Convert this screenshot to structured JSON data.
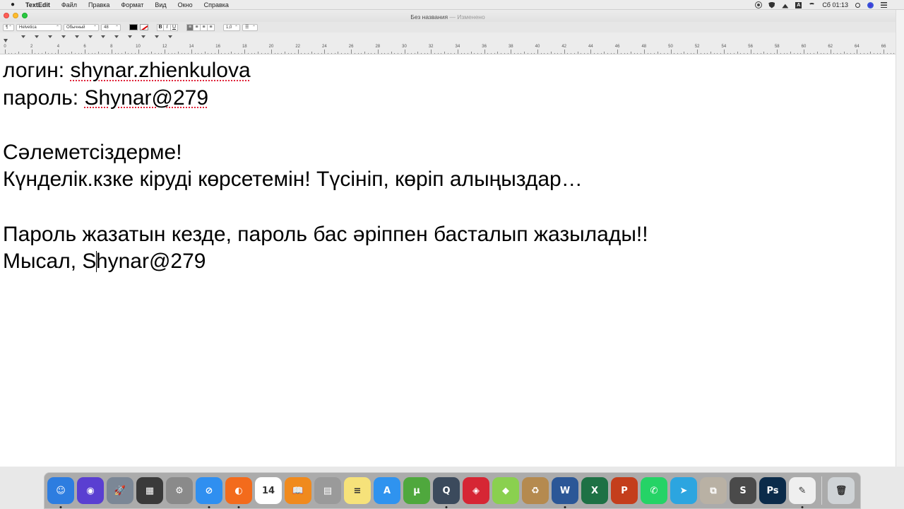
{
  "menubar": {
    "app_name": "TextEdit",
    "items": [
      "Файл",
      "Правка",
      "Формат",
      "Вид",
      "Окно",
      "Справка"
    ],
    "clock": "Сб 01:13"
  },
  "window": {
    "title": "Без названия",
    "title_sep": " — ",
    "edited": "Изменено"
  },
  "toolbar": {
    "paragraph_style": "¶",
    "font_family": "Helvetica",
    "font_style": "Обычный",
    "font_size": "48",
    "bold": "B",
    "italic": "I",
    "underline": "U",
    "line_spacing": "1,0",
    "list": "☰",
    "text_color": "#000000",
    "alignment_active": "left"
  },
  "ruler": {
    "labels": [
      "0",
      "2",
      "4",
      "6",
      "8",
      "10",
      "12",
      "14",
      "16",
      "18",
      "20",
      "22",
      "24",
      "26",
      "28",
      "30",
      "32",
      "34",
      "36",
      "38",
      "40",
      "42",
      "44",
      "46",
      "48",
      "50",
      "52",
      "54",
      "56",
      "58",
      "60",
      "62",
      "64",
      "66"
    ]
  },
  "document": {
    "lines": [
      {
        "prefix": "логин: ",
        "spell": "shynar.zhienkulova",
        "suffix": ""
      },
      {
        "prefix": "пароль: ",
        "spell": "Shynar@279",
        "suffix": ""
      },
      {
        "prefix": "",
        "spell": "",
        "suffix": ""
      },
      {
        "prefix": "Сәлеметсіздерме!",
        "spell": "",
        "suffix": ""
      },
      {
        "prefix": "Күнделік.кзке кіруді көрсетемін! Түсініп, көріп алыңыздар…",
        "spell": "",
        "suffix": ""
      },
      {
        "prefix": "",
        "spell": "",
        "suffix": ""
      },
      {
        "prefix": "Пароль жазатын кезде, пароль бас әріппен басталып жазылады!!",
        "spell": "",
        "suffix": ""
      }
    ],
    "last_line_before_caret": "Мысал, S",
    "last_line_after_caret": "hynar@279"
  },
  "dock": {
    "apps": [
      {
        "name": "finder-icon",
        "color": "#2d7de0",
        "glyph": "☺",
        "running": true
      },
      {
        "name": "siri-icon",
        "color": "#5a3fd1",
        "glyph": "◉",
        "running": false
      },
      {
        "name": "launchpad-icon",
        "color": "#7b8796",
        "glyph": "🚀",
        "running": false
      },
      {
        "name": "photo-booth-icon",
        "color": "#3a3a3a",
        "glyph": "▦",
        "running": false
      },
      {
        "name": "system-preferences-icon",
        "color": "#8a8a8a",
        "glyph": "⚙",
        "running": false
      },
      {
        "name": "safari-icon",
        "color": "#2f8ff0",
        "glyph": "⊘",
        "running": true
      },
      {
        "name": "firefox-icon",
        "color": "#f36b1c",
        "glyph": "◐",
        "running": true
      },
      {
        "name": "calendar-icon",
        "color": "#ffffff",
        "glyph": "14",
        "running": false
      },
      {
        "name": "ibooks-icon",
        "color": "#f08a1d",
        "glyph": "📖",
        "running": false
      },
      {
        "name": "calculator-icon",
        "color": "#9a9a9a",
        "glyph": "▤",
        "running": false
      },
      {
        "name": "notes-icon",
        "color": "#f6e27a",
        "glyph": "≡",
        "running": false
      },
      {
        "name": "app-store-icon",
        "color": "#2f93ef",
        "glyph": "A",
        "running": false
      },
      {
        "name": "utorrent-icon",
        "color": "#4fa83d",
        "glyph": "µ",
        "running": false
      },
      {
        "name": "quicktime-icon",
        "color": "#3b4a5c",
        "glyph": "Q",
        "running": true
      },
      {
        "name": "vpn-shield-icon",
        "color": "#d62634",
        "glyph": "◈",
        "running": false
      },
      {
        "name": "cube-app-icon",
        "color": "#8ad04f",
        "glyph": "◆",
        "running": false
      },
      {
        "name": "archive-utility-icon",
        "color": "#b58a4f",
        "glyph": "♻",
        "running": false
      },
      {
        "name": "microsoft-word-icon",
        "color": "#2b5797",
        "glyph": "W",
        "running": true
      },
      {
        "name": "microsoft-excel-icon",
        "color": "#1e7145",
        "glyph": "X",
        "running": false
      },
      {
        "name": "microsoft-powerpoint-icon",
        "color": "#c43e1c",
        "glyph": "P",
        "running": false
      },
      {
        "name": "whatsapp-icon",
        "color": "#25d366",
        "glyph": "✆",
        "running": false
      },
      {
        "name": "telegram-icon",
        "color": "#2ca5e0",
        "glyph": "➤",
        "running": false
      },
      {
        "name": "preview-icon",
        "color": "#b9b1a4",
        "glyph": "⧉",
        "running": false
      },
      {
        "name": "sublime-text-icon",
        "color": "#4a4a4a",
        "glyph": "S",
        "running": false
      },
      {
        "name": "photoshop-icon",
        "color": "#0b2b4a",
        "glyph": "Ps",
        "running": false
      },
      {
        "name": "textedit-icon",
        "color": "#efefef",
        "glyph": "✎",
        "running": true
      }
    ],
    "trash": {
      "name": "trash-icon",
      "color": "#cfd3d6",
      "glyph": "🗑",
      "running": false
    }
  }
}
